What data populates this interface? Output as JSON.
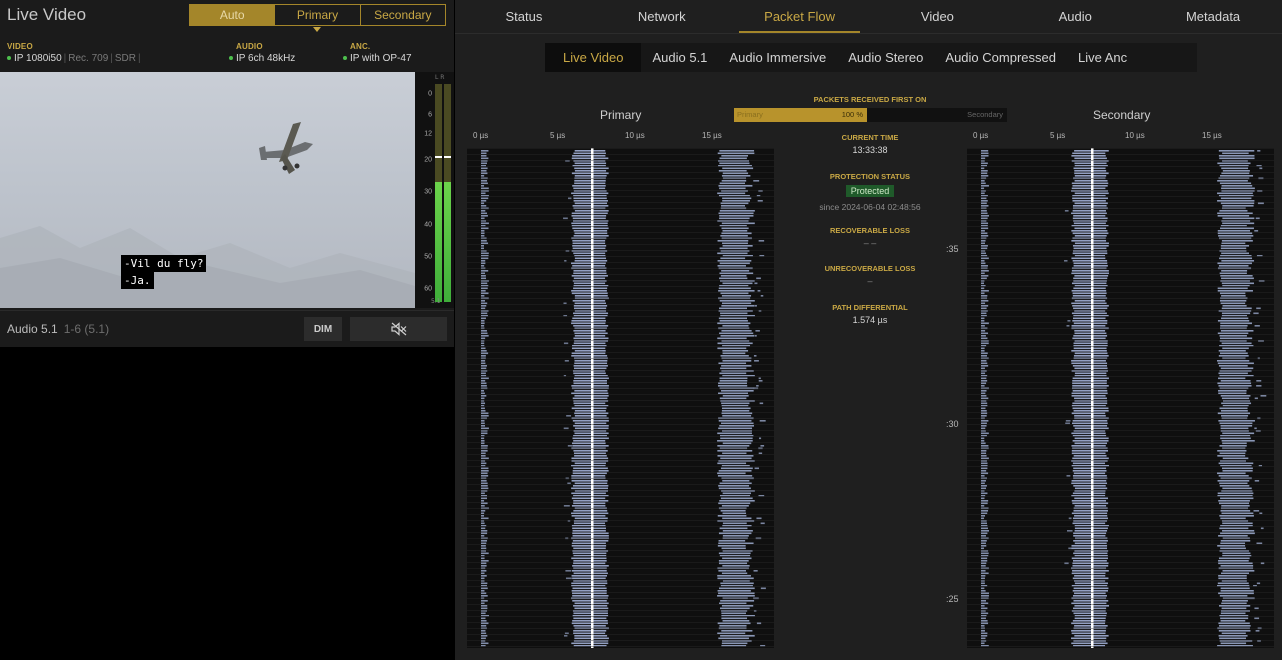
{
  "left": {
    "title": "Live Video",
    "modes": [
      "Auto",
      "Primary",
      "Secondary"
    ],
    "active_mode": "Auto",
    "selected_mode": "Primary",
    "video": {
      "head": "VIDEO",
      "value": "IP 1080i50",
      "extra1": "Rec. 709",
      "extra2": "SDR"
    },
    "audio": {
      "head": "AUDIO",
      "value": "IP 6ch 48kHz"
    },
    "anc": {
      "head": "ANC.",
      "value": "IP with OP-47"
    },
    "subtitles": [
      "-Vil du fly?",
      "-Ja."
    ],
    "meter": {
      "ticks": [
        "0",
        "6",
        "12",
        "20",
        "30",
        "40",
        "50",
        "60"
      ],
      "header": "L R",
      "footer": "5.1",
      "level_fraction": 0.55,
      "peak_fraction": 0.66
    },
    "audio_row": {
      "label": "Audio 5.1",
      "channels": "1-6 (5.1)",
      "dim_label": "DIM"
    }
  },
  "right": {
    "top_tabs": [
      "Status",
      "Network",
      "Packet Flow",
      "Video",
      "Audio",
      "Metadata"
    ],
    "active_top_tab": "Packet Flow",
    "sub_tabs": [
      "Live Video",
      "Audio 5.1",
      "Audio Immersive",
      "Audio Stereo",
      "Audio Compressed",
      "Live Anc"
    ],
    "active_sub_tab": "Live Video",
    "primary_title": "Primary",
    "secondary_title": "Secondary",
    "axis_labels": [
      "0 µs",
      "5 µs",
      "10 µs",
      "15 µs"
    ],
    "row_ticks": [
      ":35",
      ":30",
      ":25"
    ],
    "packets_first": {
      "title": "PACKETS RECEIVED FIRST ON",
      "primary_label": "Primary",
      "primary_pct": "100 %",
      "primary_fraction": 1.0,
      "secondary_label": "Secondary"
    },
    "current_time": {
      "head": "CURRENT TIME",
      "value": "13:33:38"
    },
    "protection": {
      "head": "PROTECTION STATUS",
      "value": "Protected",
      "since": "since 2024-06-04 02:48:56"
    },
    "recoverable": {
      "head": "RECOVERABLE LOSS",
      "value": "–   –"
    },
    "unrecoverable": {
      "head": "UNRECOVERABLE LOSS",
      "value": "–"
    },
    "path_diff": {
      "head": "PATH DIFFERENTIAL",
      "value": "1.574 µs"
    }
  },
  "colors": {
    "accent": "#c9a845",
    "accent_dark": "#a4862a",
    "good": "#4dc04d",
    "packet": "#a9b9e0"
  },
  "icons": {
    "mute": "speaker-muted-icon"
  }
}
